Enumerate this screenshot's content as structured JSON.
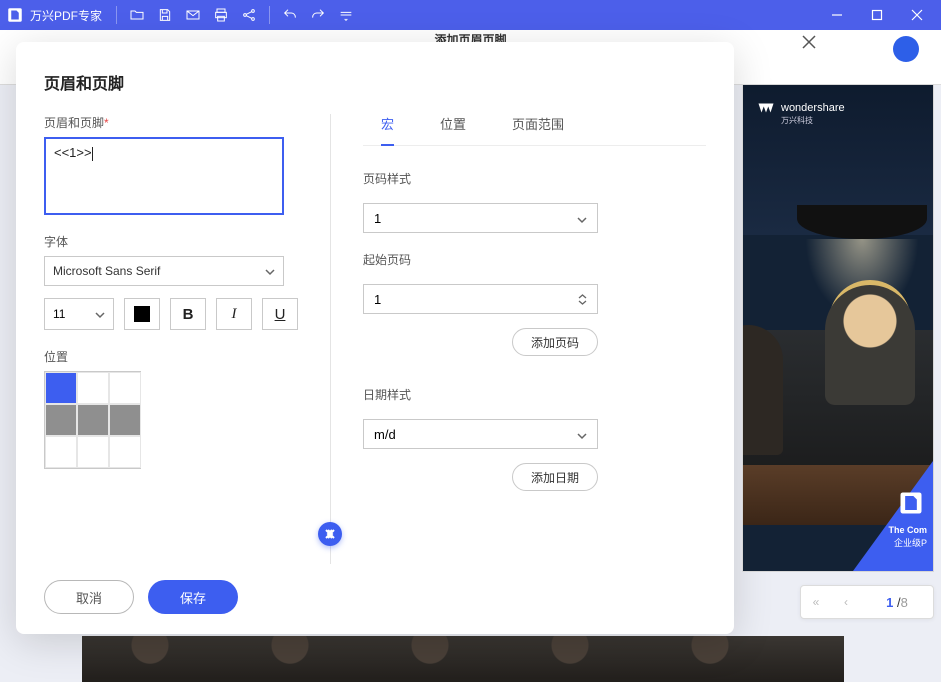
{
  "titlebar": {
    "app_name": "万兴PDF专家"
  },
  "ribbon": {
    "label": "添加页眉页脚"
  },
  "dialog": {
    "title": "页眉和页脚",
    "hf_label": "页眉和页脚",
    "hf_value": "<<1>>",
    "font_label": "字体",
    "font_value": "Microsoft Sans Serif",
    "size_value": "11",
    "bold": "B",
    "italic": "I",
    "underline": "U",
    "position_label": "位置",
    "cancel": "取消",
    "save": "保存"
  },
  "tabs": {
    "macro": "宏",
    "position": "位置",
    "range": "页面范围"
  },
  "macro": {
    "page_style_label": "页码样式",
    "page_style_value": "1",
    "start_page_label": "起始页码",
    "start_page_value": "1",
    "add_page": "添加页码",
    "date_style_label": "日期样式",
    "date_style_value": "m/d",
    "add_date": "添加日期"
  },
  "preview": {
    "brand": "wondershare",
    "brand_sub": "万兴科技",
    "corner1": "The Com",
    "corner2": "企业级P"
  },
  "pager": {
    "current": "1",
    "total": "8"
  }
}
